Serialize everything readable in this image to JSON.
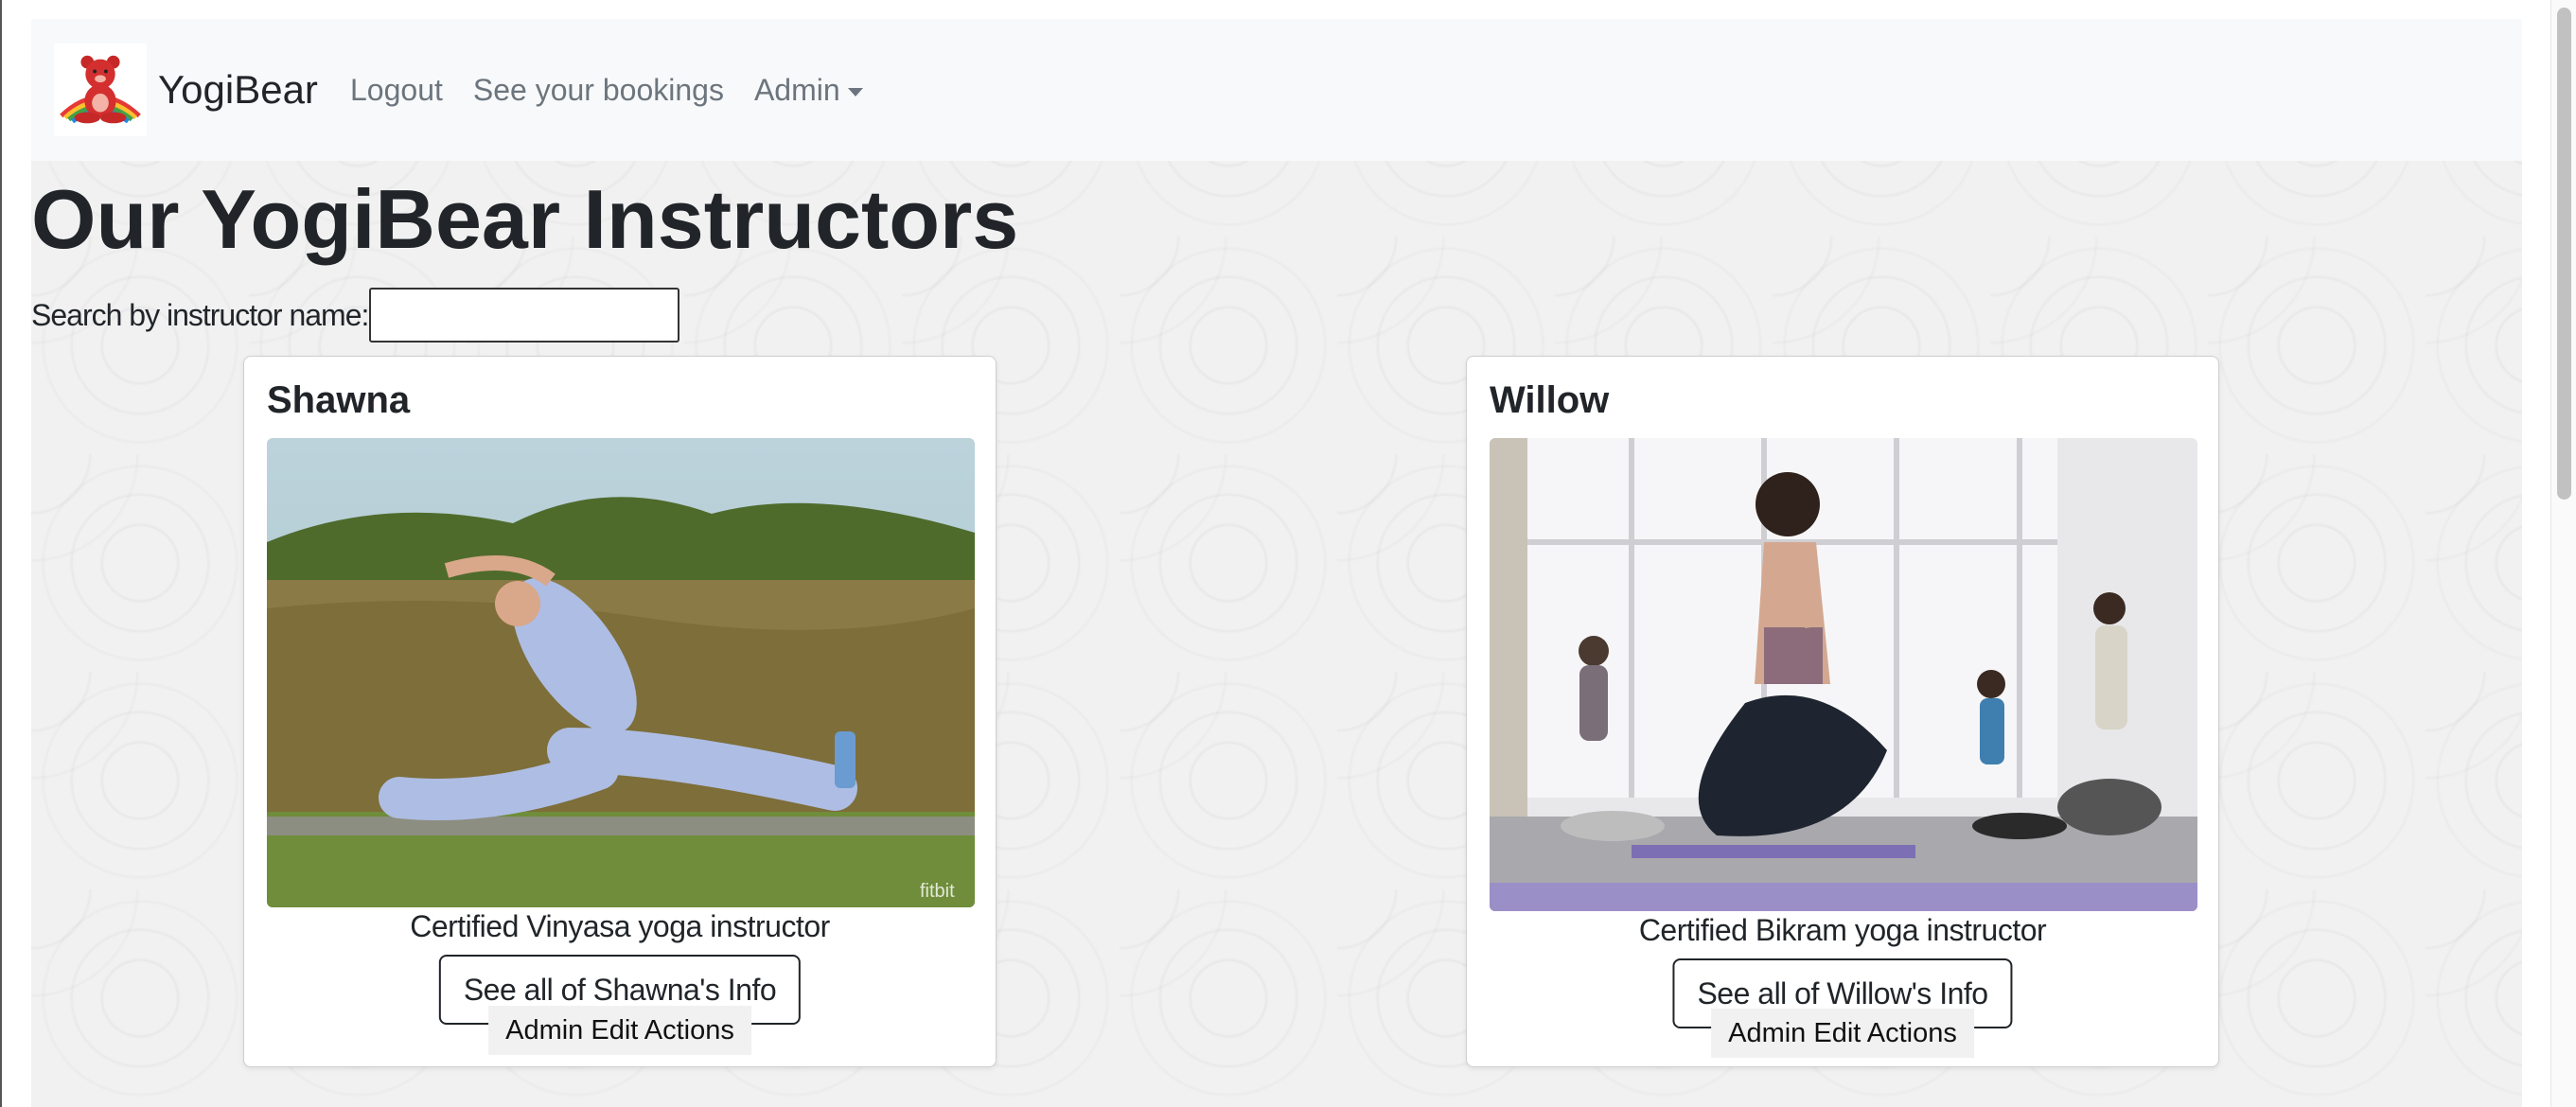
{
  "navbar": {
    "brand_name": "YogiBear",
    "links": [
      {
        "label": "Logout"
      },
      {
        "label": "See your bookings"
      },
      {
        "label": "Admin"
      }
    ]
  },
  "page": {
    "title": "Our YogiBear Instructors"
  },
  "search": {
    "label": "Search by instructor name:",
    "value": "",
    "placeholder": ""
  },
  "instructors": [
    {
      "name": "Shawna",
      "description": "Certified Vinyasa yoga instructor",
      "info_button": "See all of Shawna's Info",
      "admin_button": "Admin Edit Actions",
      "photo_caption": "fitbit"
    },
    {
      "name": "Willow",
      "description": "Certified Bikram yoga instructor",
      "info_button": "See all of Willow's Info",
      "admin_button": "Admin Edit Actions"
    }
  ],
  "colors": {
    "navbar_bg": "#f8f9fa",
    "page_bg": "#f1f1f1",
    "text": "#212529",
    "nav_link": "#6c757d"
  }
}
